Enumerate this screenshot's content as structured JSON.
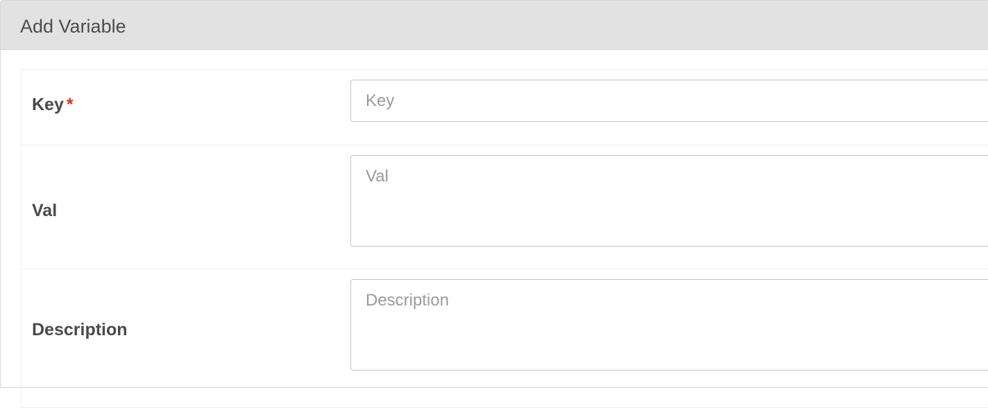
{
  "panel": {
    "title": "Add Variable"
  },
  "fields": {
    "key": {
      "label": "Key",
      "required_mark": "*",
      "value": "",
      "placeholder": "Key"
    },
    "val": {
      "label": "Val",
      "value": "",
      "placeholder": "Val"
    },
    "description": {
      "label": "Description",
      "value": "",
      "placeholder": "Description"
    }
  },
  "colors": {
    "header_background": "#e2e2e2",
    "required_mark": "#e0321e",
    "label_text": "#4a4a4a",
    "placeholder_text": "#9a9a9a",
    "input_border": "#c4c4c4"
  }
}
